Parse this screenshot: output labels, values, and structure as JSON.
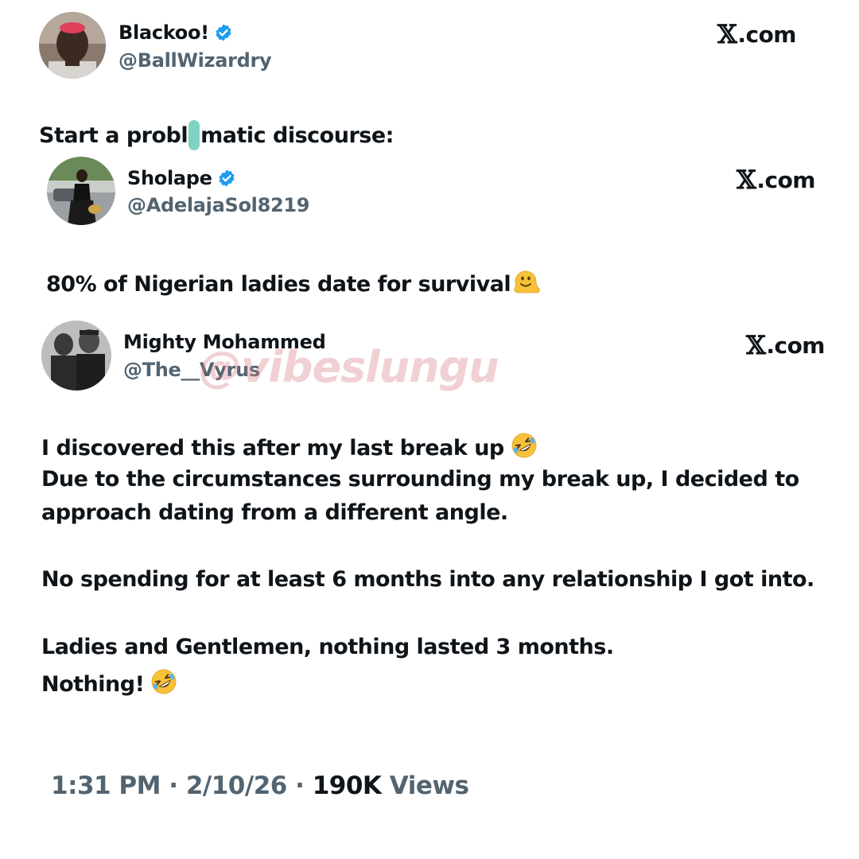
{
  "tweet": {
    "author": {
      "name": "Blackoo!",
      "handle": "@BallWizardry",
      "verified": true
    },
    "brand": "com",
    "text_before_cursor": "Start a probl",
    "text_after_cursor": "matic discourse:",
    "timestamp": "1:31 PM",
    "date": "2/10/26",
    "views_count": "190K",
    "views_label": "Views",
    "separator": "·"
  },
  "quote1": {
    "author": {
      "name": "Sholape",
      "handle": "@AdelajaSol8219",
      "verified": true
    },
    "brand": "com",
    "text": "80% of Nigerian ladies date for survival"
  },
  "quote2": {
    "author": {
      "name": "Mighty Mohammed",
      "handle": "@The__Vyrus",
      "verified": false
    },
    "brand": "com",
    "lines": [
      "I discovered this after my last break up",
      "Due to the circumstances surrounding my break up, I decided to",
      "approach dating from a different angle.",
      "No spending for at least 6 months into any relationship I got into.",
      "Ladies and Gentlemen, nothing lasted 3 months.",
      "Nothing!"
    ]
  },
  "watermark": "@vibeslungu",
  "colors": {
    "text": "#0f1419",
    "secondary": "#536471",
    "verified": "#1d9bf0",
    "cursor": "#7fd1c1",
    "watermark": "#d67882"
  },
  "icons": {
    "verified": "verified-badge-icon",
    "x_logo": "x-logo-icon",
    "melting_face": "melting-face-emoji",
    "rofl": "rolling-on-floor-laughing-emoji"
  }
}
